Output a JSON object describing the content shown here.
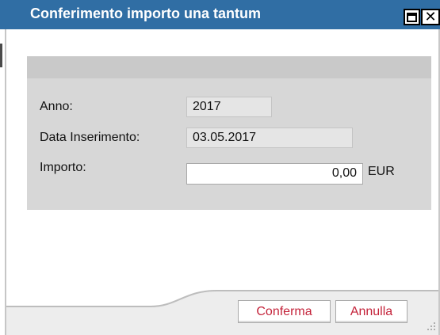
{
  "window": {
    "title": "Conferimento importo una tantum",
    "maximize_icon": "maximize-icon",
    "close_icon": "close-icon",
    "close_glyph": "✕",
    "title_bar_color": "#306ea4"
  },
  "form": {
    "anno_label": "Anno:",
    "anno_value": "2017",
    "data_label": "Data Inserimento:",
    "data_value": "03.05.2017",
    "importo_label": "Importo:",
    "importo_value": "0,00",
    "currency": "EUR"
  },
  "buttons": {
    "confirm_label": "Conferma",
    "cancel_label": "Annulla",
    "label_color": "#c4233a"
  }
}
